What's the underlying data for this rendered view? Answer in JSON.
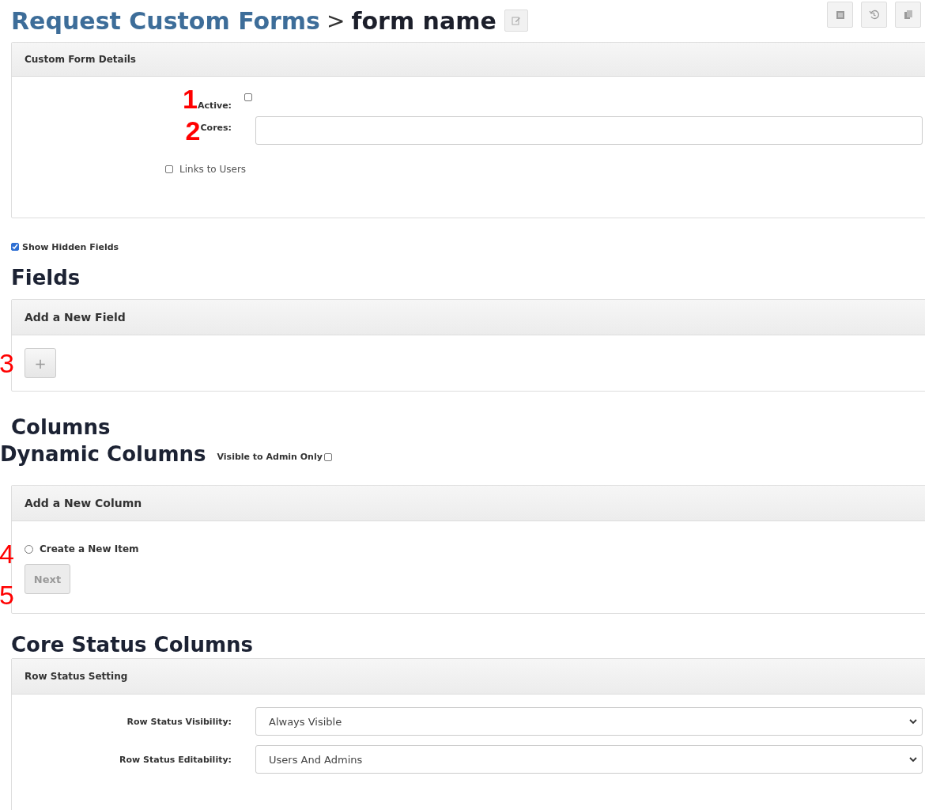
{
  "header": {
    "breadcrumb_link": "Request Custom Forms",
    "separator": ">",
    "form_name": "form name"
  },
  "details_panel": {
    "title": "Custom Form Details",
    "active": {
      "marker": "1",
      "label": "Active:",
      "checked": false
    },
    "cores": {
      "marker": "2",
      "label": "Cores:"
    },
    "links_to_users": {
      "label": "Links to Users",
      "checked": false
    }
  },
  "show_hidden_fields": {
    "label": "Show Hidden Fields",
    "checked": true
  },
  "fields": {
    "heading": "Fields",
    "panel_title": "Add a New Field",
    "marker": "3",
    "add_button": "+"
  },
  "columns": {
    "heading": "Columns",
    "dynamic_heading": "Dynamic Columns",
    "visible_admin": {
      "label": "Visible to Admin Only",
      "checked": false
    },
    "panel_title": "Add a New Column",
    "radio": {
      "marker": "4",
      "label": "Create a New Item",
      "selected": false
    },
    "next": {
      "marker": "5",
      "label": "Next",
      "disabled": true
    }
  },
  "core_status": {
    "heading": "Core Status Columns",
    "panel_title": "Row Status Setting",
    "rows": [
      {
        "label": "Row Status Visibility:",
        "value": "Always Visible"
      },
      {
        "label": "Row Status Editability:",
        "value": "Users And Admins"
      }
    ]
  }
}
